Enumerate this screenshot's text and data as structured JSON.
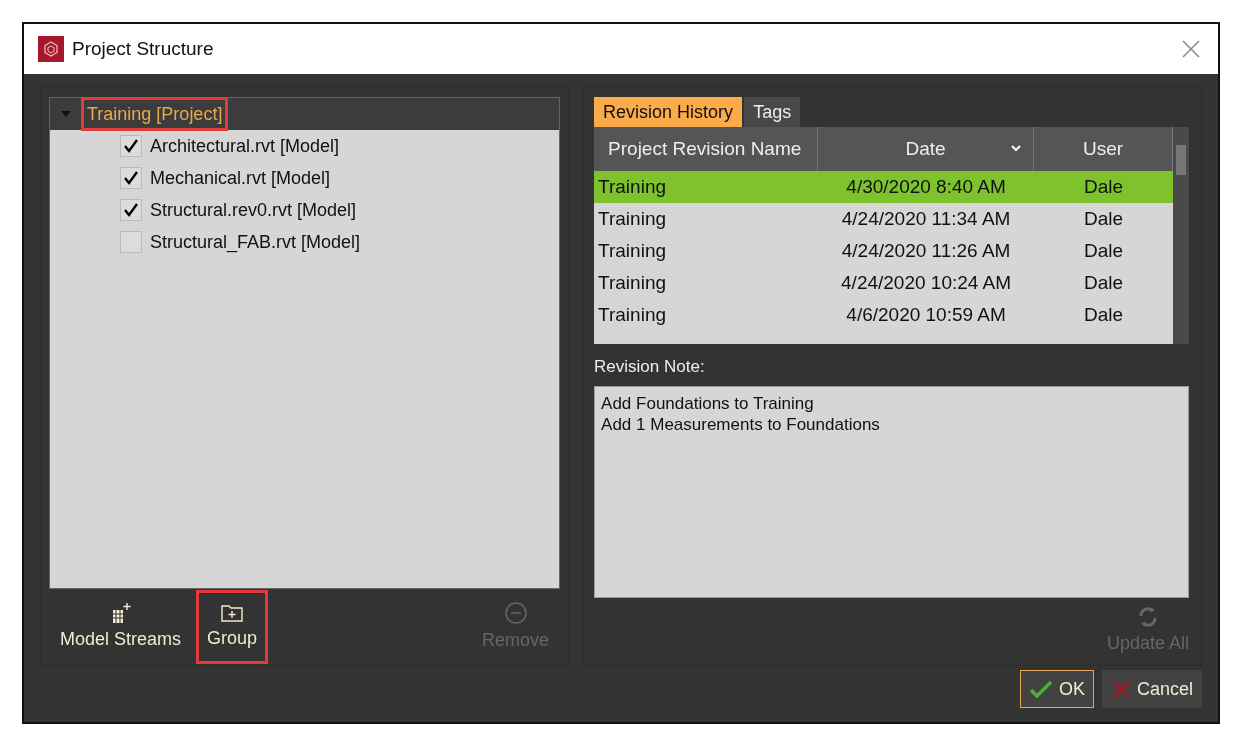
{
  "window": {
    "title": "Project Structure"
  },
  "tree": {
    "label": "Training [Project]",
    "expanded": true,
    "highlighted": true,
    "children": [
      {
        "label": "Architectural.rvt [Model]",
        "checked": true
      },
      {
        "label": "Mechanical.rvt [Model]",
        "checked": true
      },
      {
        "label": "Structural.rev0.rvt [Model]",
        "checked": true
      },
      {
        "label": "Structural_FAB.rvt [Model]",
        "checked": false
      }
    ]
  },
  "left_toolbar": [
    {
      "kind": "streams",
      "label": "Model Streams",
      "disabled": false,
      "highlighted": false
    },
    {
      "kind": "group",
      "label": "Group",
      "disabled": false,
      "highlighted": true
    },
    {
      "kind": "remove",
      "label": "Remove",
      "disabled": true,
      "highlighted": false
    }
  ],
  "tabs": [
    {
      "label": "Revision History",
      "selected": true
    },
    {
      "label": "Tags",
      "selected": false
    }
  ],
  "table": {
    "columns": [
      "Project Revision Name",
      "Date",
      "User"
    ],
    "rows": [
      {
        "cells": [
          "Training",
          "4/30/2020 8:40 AM",
          "Dale"
        ],
        "selected": true
      },
      {
        "cells": [
          "Training",
          "4/24/2020 11:34 AM",
          "Dale"
        ],
        "selected": false
      },
      {
        "cells": [
          "Training",
          "4/24/2020 11:26 AM",
          "Dale"
        ],
        "selected": false
      },
      {
        "cells": [
          "Training",
          "4/24/2020 10:24 AM",
          "Dale"
        ],
        "selected": false
      },
      {
        "cells": [
          "Training",
          "4/6/2020 10:59 AM",
          "Dale"
        ],
        "selected": false
      }
    ]
  },
  "revision_note": {
    "label": "Revision Note:",
    "lines": [
      "Add Foundations to Training",
      "Add 1 Measurements to Foundations"
    ]
  },
  "update_all": {
    "label": "Update All",
    "disabled": true
  },
  "buttons": [
    {
      "kind": "ok",
      "label": "OK"
    },
    {
      "kind": "cancel",
      "label": "Cancel"
    }
  ]
}
